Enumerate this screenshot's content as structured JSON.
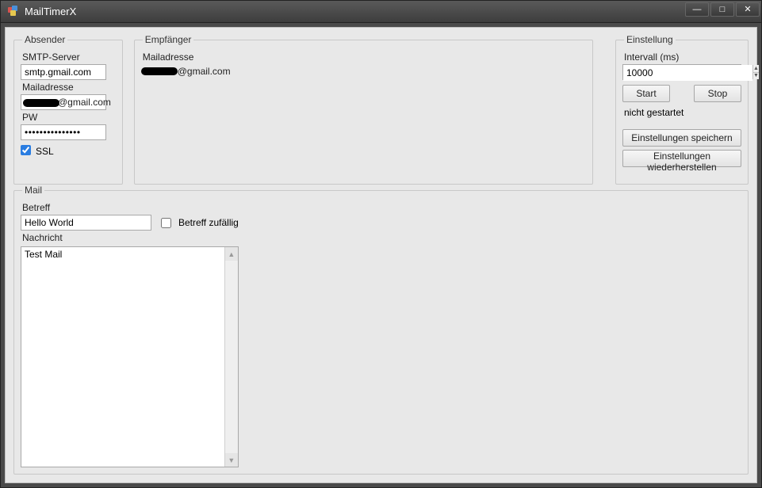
{
  "window": {
    "title": "MailTimerX"
  },
  "absender": {
    "legend": "Absender",
    "smtp_label": "SMTP-Server",
    "smtp_value": "smtp.gmail.com",
    "mail_label": "Mailadresse",
    "mail_value_suffix": "@gmail.com",
    "pw_label": "PW",
    "pw_value": "•••••••••••••••",
    "ssl_label": "SSL",
    "ssl_checked": true
  },
  "empfanger": {
    "legend": "Empfänger",
    "mail_label": "Mailadresse",
    "mail_value_suffix": "@gmail.com"
  },
  "einstellung": {
    "legend": "Einstellung",
    "interval_label": "Intervall (ms)",
    "interval_value": "10000",
    "start_label": "Start",
    "stop_label": "Stop",
    "status_text": "nicht gestartet",
    "save_label": "Einstellungen speichern",
    "restore_label": "Einstellungen wiederherstellen"
  },
  "mail": {
    "legend": "Mail",
    "subject_label": "Betreff",
    "subject_value": "Hello World",
    "random_subject_label": "Betreff zufällig",
    "random_subject_checked": false,
    "message_label": "Nachricht",
    "message_value": "Test Mail"
  }
}
